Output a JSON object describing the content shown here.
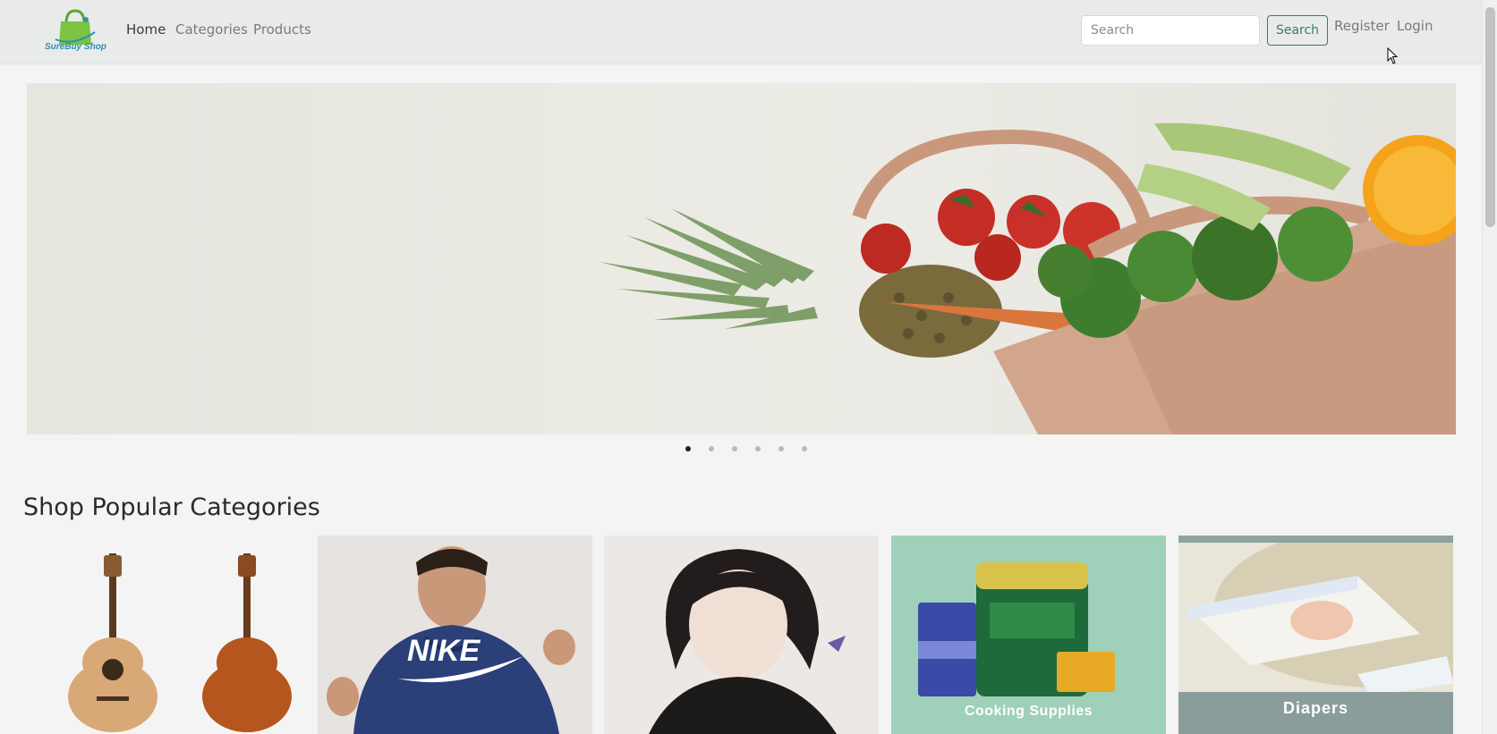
{
  "brand": {
    "name": "SureBuy Shop",
    "color": "#2f8fb5",
    "logo_icon": "shopping-bag-icon",
    "logo_color": "#6cbf3a"
  },
  "nav": {
    "links": [
      {
        "label": "Home",
        "active": true
      },
      {
        "label": "Categories",
        "active": false
      },
      {
        "label": "Products",
        "active": false
      }
    ]
  },
  "search": {
    "placeholder": "Search",
    "button_label": "Search",
    "button_color": "#3d7a5e"
  },
  "auth": {
    "register_label": "Register",
    "login_label": "Login"
  },
  "carousel": {
    "slide_count": 6,
    "active_index": 0
  },
  "popular": {
    "title": "Shop Popular Categories",
    "cards": [
      {
        "label": "",
        "image": "acoustic-guitars"
      },
      {
        "label": "",
        "image": "man-in-nike-hoodie"
      },
      {
        "label": "",
        "image": "anime-girl-illustration"
      },
      {
        "label": "Cooking Supplies",
        "image": "cooking-supplies"
      },
      {
        "label": "Diapers",
        "image": "diapers"
      }
    ]
  }
}
